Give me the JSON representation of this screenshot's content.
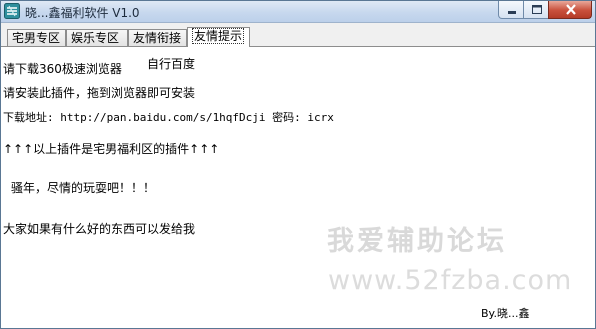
{
  "window": {
    "title": "晓...鑫福利软件  V1.0",
    "icon": "app-icon",
    "controls": {
      "minimize": "minimize-icon",
      "maximize": "maximize-icon",
      "close": "close-icon"
    }
  },
  "tabs": [
    {
      "label": "宅男专区",
      "active": false
    },
    {
      "label": "娱乐专区",
      "active": false
    },
    {
      "label": "友情衔接",
      "active": false
    },
    {
      "label": "友情提示",
      "active": true
    }
  ],
  "content": {
    "line1": "请下载360极速浏览器",
    "line1_extra": "自行百度",
    "line2": "请安装此插件，拖到浏览器即可安装",
    "line3": "下载地址: http://pan.baidu.com/s/1hqfDcji 密码: icrx",
    "line4": "↑↑↑以上插件是宅男福利区的插件↑↑↑",
    "line5": "骚年，尽情的玩耍吧！！！",
    "line6": "大家如果有什么好的东西可以发给我",
    "byline": "By.晓...鑫"
  },
  "watermark": {
    "line1": "我爱辅助论坛",
    "line2": "www.52fzba.com"
  }
}
